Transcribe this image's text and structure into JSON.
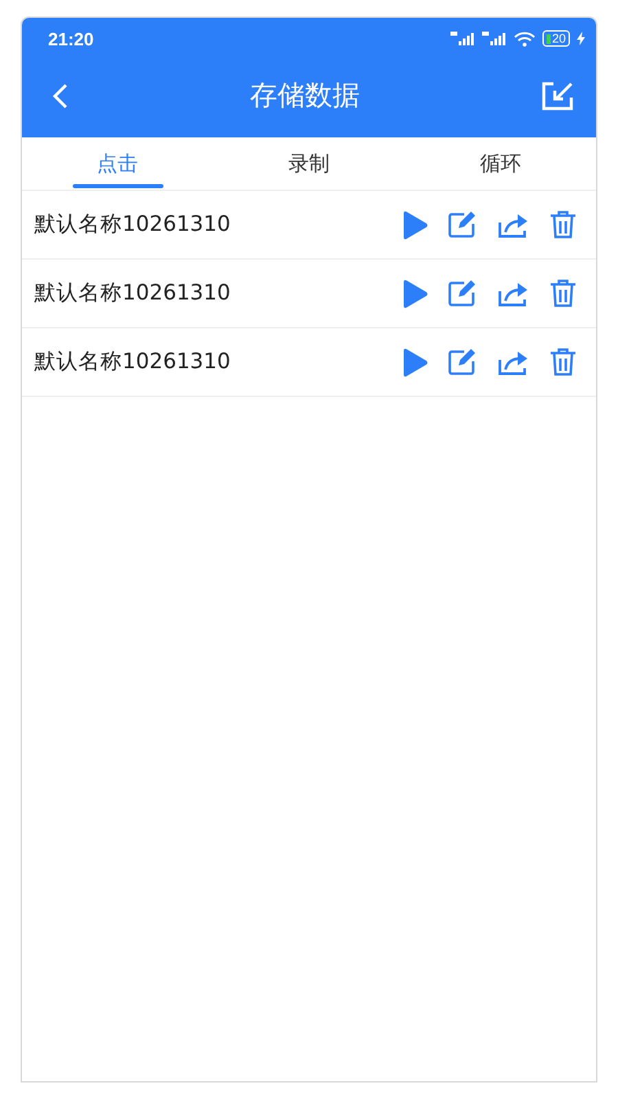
{
  "status_bar": {
    "time": "21:20",
    "battery": "20"
  },
  "toolbar": {
    "title": "存储数据"
  },
  "tabs": [
    {
      "label": "点击",
      "selected": true
    },
    {
      "label": "录制",
      "selected": false
    },
    {
      "label": "循环",
      "selected": false
    }
  ],
  "records": [
    {
      "name": "默认名称10261310"
    },
    {
      "name": "默认名称10261310"
    },
    {
      "name": "默认名称10261310"
    }
  ]
}
